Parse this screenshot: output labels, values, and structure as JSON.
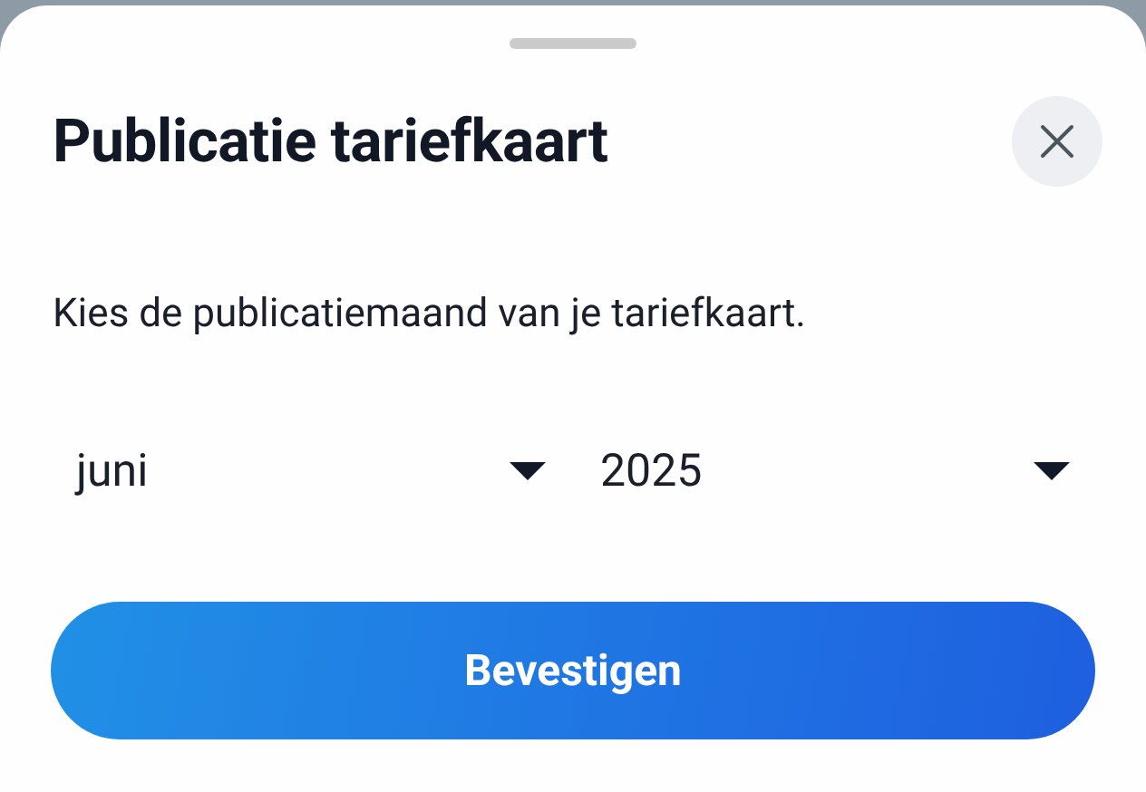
{
  "sheet": {
    "title": "Publicatie tariefkaart",
    "description": "Kies de publicatiemaand van je tariefkaart.",
    "dropdowns": [
      "juni",
      "2025"
    ],
    "confirm_button": "Bevestigen"
  }
}
